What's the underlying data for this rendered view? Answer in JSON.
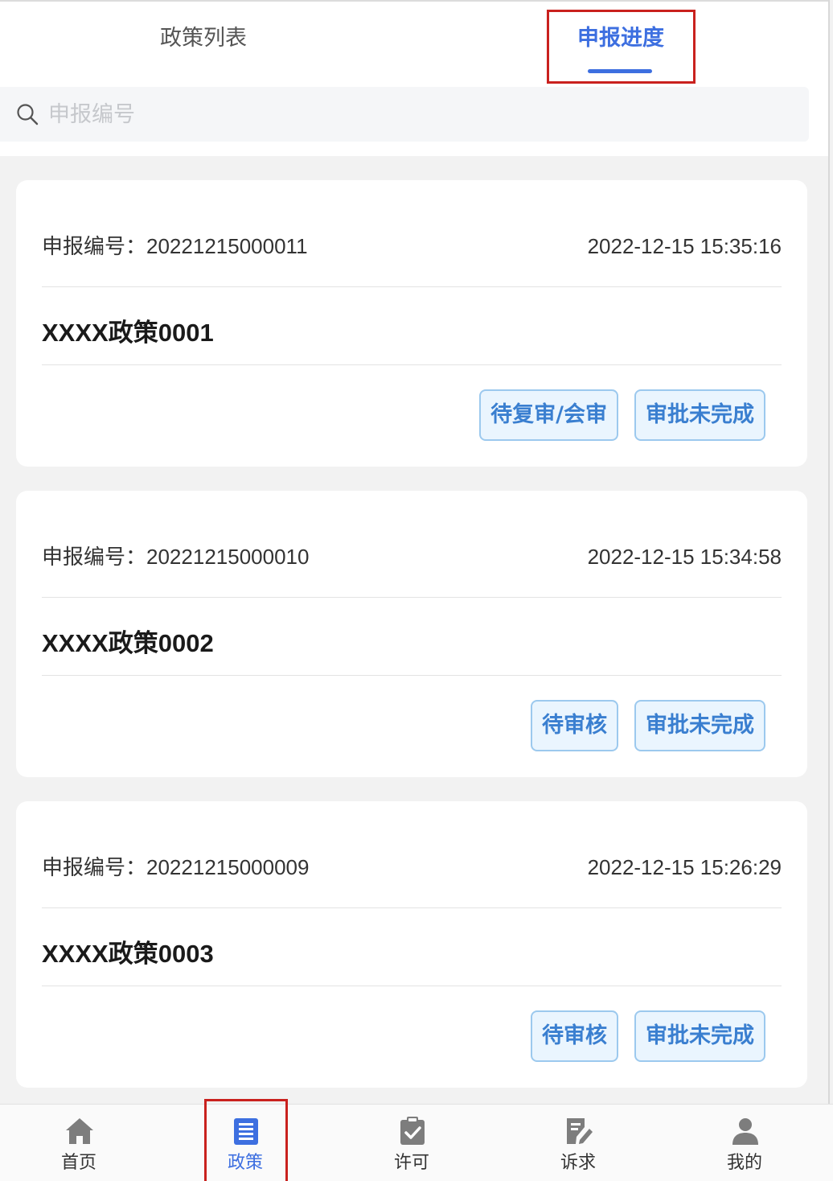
{
  "tabs": [
    {
      "label": "政策列表",
      "active": false
    },
    {
      "label": "申报进度",
      "active": true
    }
  ],
  "search": {
    "placeholder": "申报编号"
  },
  "records": [
    {
      "no_label": "申报编号：",
      "no": "20221215000011",
      "time": "2022-12-15 15:35:16",
      "title_prefix": "XXXX",
      "title_cn": "政策",
      "title_suffix": "0001",
      "tags": [
        "待复审/会审",
        "审批未完成"
      ]
    },
    {
      "no_label": "申报编号：",
      "no": "20221215000010",
      "time": "2022-12-15 15:34:58",
      "title_prefix": "XXXX",
      "title_cn": "政策",
      "title_suffix": "0002",
      "tags": [
        "待审核",
        "审批未完成"
      ]
    },
    {
      "no_label": "申报编号：",
      "no": "20221215000009",
      "time": "2022-12-15 15:26:29",
      "title_prefix": "XXXX",
      "title_cn": "政策",
      "title_suffix": "0003",
      "tags": [
        "待审核",
        "审批未完成"
      ]
    }
  ],
  "tabbar": [
    {
      "label": "首页",
      "icon": "home-icon",
      "active": false
    },
    {
      "label": "政策",
      "icon": "policy-list-icon",
      "active": true
    },
    {
      "label": "许可",
      "icon": "clipboard-check-icon",
      "active": false
    },
    {
      "label": "诉求",
      "icon": "edit-document-icon",
      "active": false
    },
    {
      "label": "我的",
      "icon": "user-icon",
      "active": false
    }
  ],
  "colors": {
    "accent": "#3d6fe0",
    "tag_text": "#3a7fd0",
    "tag_bg": "#eaf5fe",
    "highlight": "#c9211e"
  }
}
